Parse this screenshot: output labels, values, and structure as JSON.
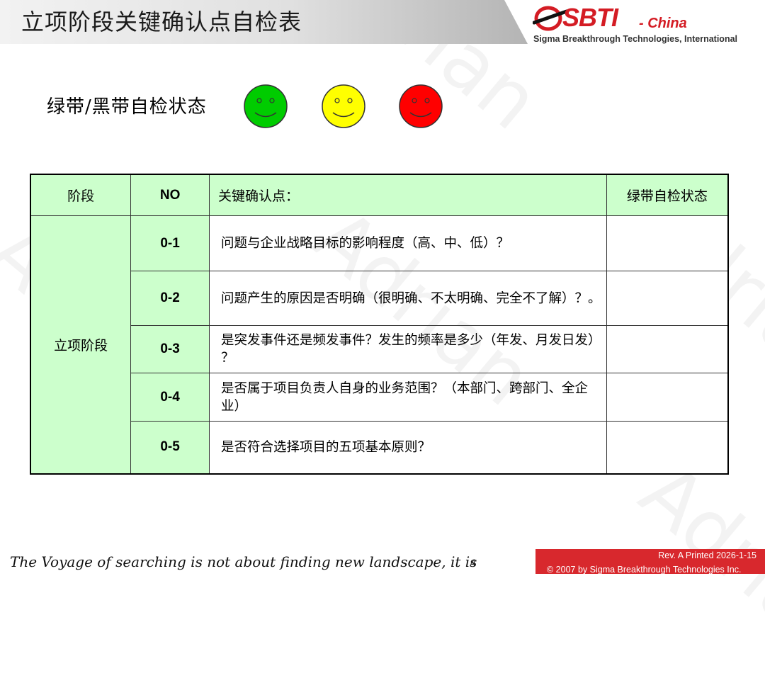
{
  "header": {
    "title": "立项阶段关键确认点自检表",
    "logo_text": "SBTI",
    "logo_suffix": "- China",
    "logo_subtitle": "Sigma Breakthrough Technologies, International"
  },
  "status_legend": {
    "label": "绿带/黑带自检状态",
    "faces": [
      {
        "icon": "smiley-green-icon",
        "color": "#00cc00"
      },
      {
        "icon": "smiley-yellow-icon",
        "color": "#ffff00"
      },
      {
        "icon": "smiley-red-icon",
        "color": "#ff0000"
      }
    ]
  },
  "table": {
    "headers": {
      "stage": "阶段",
      "no": "NO",
      "point": "关键确认点：",
      "status": "绿带自检状态"
    },
    "stage_name": "立项阶段",
    "rows": [
      {
        "no": "0-1",
        "point": "问题与企业战略目标的影响程度（高、中、低）？",
        "status": ""
      },
      {
        "no": "0-2",
        "point": "问题产生的原因是否明确（很明确、不太明确、完全不了解）？。",
        "status": ""
      },
      {
        "no": "0-3",
        "point": "是突发事件还是频发事件？发生的频率是多少（年发、月发日发） ？",
        "status": ""
      },
      {
        "no": "0-4",
        "point": "是否属于项目负责人自身的业务范围？（本部门、跨部门、全企业）",
        "status": ""
      },
      {
        "no": "0-5",
        "point": "是否符合选择项目的五项基本原则？",
        "status": ""
      }
    ]
  },
  "footer": {
    "quote": "The Voyage of searching is not about finding new landscape, it is",
    "page_number": "4",
    "revision": "Rev. A   Printed 2026-1-15",
    "copyright": "© 2007 by Sigma Breakthrough Technologies Inc."
  },
  "watermark": "Adrian",
  "colors": {
    "header_green": "#ccffcc",
    "brand_red": "#d8282d"
  }
}
